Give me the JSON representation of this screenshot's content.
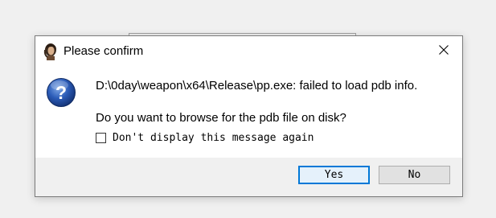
{
  "dialog": {
    "title": "Please confirm",
    "message": "D:\\0day\\weapon\\x64\\Release\\pp.exe: failed to load pdb info.",
    "question": "Do you want to browse for the pdb file on disk?",
    "checkbox": {
      "label": "Don't display this message again",
      "checked": false
    },
    "buttons": {
      "yes": "Yes",
      "no": "No"
    },
    "default_button": "yes",
    "icon": "question-icon"
  },
  "colors": {
    "accent": "#0078d7",
    "footer_bg": "#f0f0f0",
    "question_icon": "#1f4fa8"
  }
}
